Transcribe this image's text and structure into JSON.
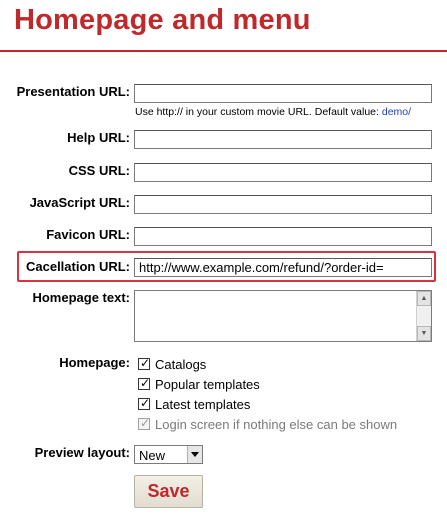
{
  "page": {
    "title": "Homepage and menu"
  },
  "fields": {
    "presentation": {
      "label": "Presentation URL:",
      "value": "",
      "hint": "Use http:// in your custom movie URL. Default value:",
      "hint_link": "demo/"
    },
    "help": {
      "label": "Help URL:",
      "value": ""
    },
    "css": {
      "label": "CSS URL:",
      "value": ""
    },
    "javascript": {
      "label": "JavaScript URL:",
      "value": ""
    },
    "favicon": {
      "label": "Favicon URL:",
      "value": ""
    },
    "cancellation": {
      "label": "Cacellation URL:",
      "value": "http://www.example.com/refund/?order-id="
    },
    "homepage_text": {
      "label": "Homepage text:",
      "value": ""
    }
  },
  "homepage": {
    "label": "Homepage:",
    "options": [
      {
        "label": "Catalogs",
        "checked": true,
        "enabled": true
      },
      {
        "label": "Popular templates",
        "checked": true,
        "enabled": true
      },
      {
        "label": "Latest templates",
        "checked": true,
        "enabled": true
      },
      {
        "label": "Login screen if nothing else can be shown",
        "checked": true,
        "enabled": false
      }
    ]
  },
  "preview_layout": {
    "label": "Preview layout:",
    "selected": "New"
  },
  "buttons": {
    "save": "Save"
  },
  "colors": {
    "accent": "#c0282a",
    "highlight_border": "#d9343c",
    "link": "#1f3fbf"
  }
}
